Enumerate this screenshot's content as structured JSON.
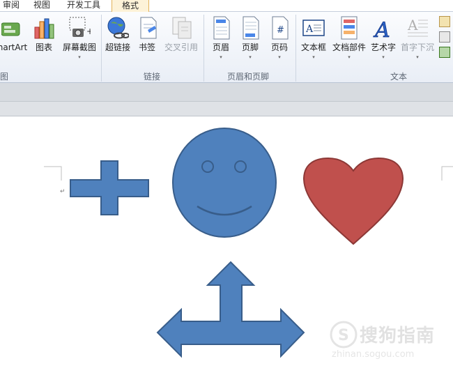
{
  "tabs": [
    {
      "label": "审阅",
      "active": false
    },
    {
      "label": "视图",
      "active": false
    },
    {
      "label": "开发工具",
      "active": false
    },
    {
      "label": "格式",
      "active": true
    }
  ],
  "ribbon": {
    "groups": {
      "illustrations": {
        "label": "图"
      },
      "links": {
        "label": "链接"
      },
      "header_footer": {
        "label": "页眉和页脚"
      },
      "text": {
        "label": "文本"
      }
    },
    "buttons": {
      "smartart": {
        "label": "nartArt",
        "icon": "smartart-icon"
      },
      "chart": {
        "label": "图表",
        "icon": "chart-icon"
      },
      "screenshot": {
        "label": "屏幕截图",
        "icon": "screenshot-icon",
        "caret": "▾"
      },
      "hyperlink": {
        "label": "超链接",
        "icon": "hyperlink-icon"
      },
      "bookmark": {
        "label": "书签",
        "icon": "bookmark-icon"
      },
      "crossref": {
        "label": "交叉引用",
        "icon": "crossref-icon",
        "disabled": true
      },
      "header": {
        "label": "页眉",
        "icon": "header-icon",
        "caret": "▾"
      },
      "footer": {
        "label": "页脚",
        "icon": "footer-icon",
        "caret": "▾"
      },
      "pagenum": {
        "label": "页码",
        "icon": "page-number-icon",
        "caret": "▾"
      },
      "textbox": {
        "label": "文本框",
        "icon": "textbox-icon",
        "caret": "▾"
      },
      "docparts": {
        "label": "文档部件",
        "icon": "docparts-icon",
        "caret": "▾"
      },
      "wordart": {
        "label": "艺术字",
        "icon": "wordart-icon",
        "caret": "▾"
      },
      "dropcap": {
        "label": "首字下沉",
        "icon": "dropcap-icon",
        "caret": "▾",
        "disabled": true
      }
    }
  },
  "document": {
    "paragraph_mark": "↵",
    "shapes": {
      "plus": {
        "fill": "#4f81bd",
        "stroke": "#385d8a"
      },
      "smiley": {
        "fill": "#4f81bd",
        "stroke": "#385d8a"
      },
      "heart": {
        "fill": "#c0504d",
        "stroke": "#8c3836"
      },
      "arrow": {
        "fill": "#4f81bd",
        "stroke": "#385d8a"
      }
    }
  },
  "watermark": {
    "text": "搜狗指南",
    "url": "zhinan.sogou.com"
  }
}
